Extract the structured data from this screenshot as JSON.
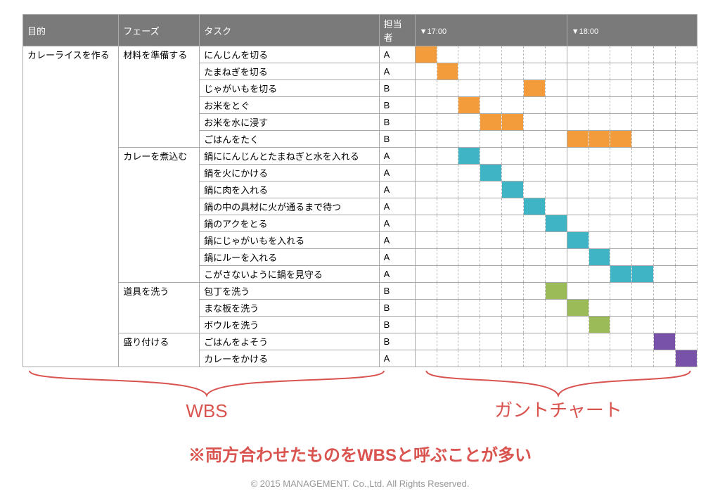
{
  "headers": {
    "purpose": "目的",
    "phase": "フェーズ",
    "task": "タスク",
    "owner": "担当者",
    "time1": "▼17:00",
    "time2": "▼18:00"
  },
  "purpose_label": "カレーライスを作る",
  "phases": [
    {
      "name": "材料を準備する",
      "rows": 6
    },
    {
      "name": "カレーを煮込む",
      "rows": 8
    },
    {
      "name": "道具を洗う",
      "rows": 3
    },
    {
      "name": "盛り付ける",
      "rows": 2
    }
  ],
  "tasks": [
    {
      "task": "にんじんを切る",
      "owner": "A",
      "start": 0,
      "len": 1,
      "color": "orange"
    },
    {
      "task": "たまねぎを切る",
      "owner": "A",
      "start": 1,
      "len": 1,
      "color": "orange"
    },
    {
      "task": "じゃがいもを切る",
      "owner": "B",
      "start": 5,
      "len": 1,
      "color": "orange"
    },
    {
      "task": "お米をとぐ",
      "owner": "B",
      "start": 2,
      "len": 1,
      "color": "orange"
    },
    {
      "task": "お米を水に浸す",
      "owner": "B",
      "start": 3,
      "len": 2,
      "color": "orange"
    },
    {
      "task": "ごはんをたく",
      "owner": "B",
      "start": 7,
      "len": 3,
      "color": "orange"
    },
    {
      "task": "鍋ににんじんとたまねぎと水を入れる",
      "owner": "A",
      "start": 2,
      "len": 1,
      "color": "teal"
    },
    {
      "task": "鍋を火にかける",
      "owner": "A",
      "start": 3,
      "len": 1,
      "color": "teal"
    },
    {
      "task": "鍋に肉を入れる",
      "owner": "A",
      "start": 4,
      "len": 1,
      "color": "teal"
    },
    {
      "task": "鍋の中の具材に火が通るまで待つ",
      "owner": "A",
      "start": 5,
      "len": 1,
      "color": "teal"
    },
    {
      "task": "鍋のアクをとる",
      "owner": "A",
      "start": 6,
      "len": 1,
      "color": "teal"
    },
    {
      "task": "鍋にじゃがいもを入れる",
      "owner": "A",
      "start": 7,
      "len": 1,
      "color": "teal"
    },
    {
      "task": "鍋にルーを入れる",
      "owner": "A",
      "start": 8,
      "len": 1,
      "color": "teal"
    },
    {
      "task": "こがさないように鍋を見守る",
      "owner": "A",
      "start": 9,
      "len": 2,
      "color": "teal"
    },
    {
      "task": "包丁を洗う",
      "owner": "B",
      "start": 6,
      "len": 1,
      "color": "green"
    },
    {
      "task": "まな板を洗う",
      "owner": "B",
      "start": 7,
      "len": 1,
      "color": "green"
    },
    {
      "task": "ボウルを洗う",
      "owner": "B",
      "start": 8,
      "len": 1,
      "color": "green"
    },
    {
      "task": "ごはんをよそう",
      "owner": "B",
      "start": 11,
      "len": 1,
      "color": "purple"
    },
    {
      "task": "カレーをかける",
      "owner": "A",
      "start": 12,
      "len": 1,
      "color": "purple"
    }
  ],
  "labels": {
    "wbs": "WBS",
    "gantt": "ガントチャート",
    "note": "※両方合わせたものをWBSと呼ぶことが多い",
    "copyright": "© 2015 MANAGEMENT. Co.,Ltd. All Rights Reserved."
  },
  "chart_data": {
    "type": "gantt",
    "title": "カレーライスを作る WBS + ガントチャート",
    "time_axis": {
      "start": "17:00",
      "end": "18:00",
      "slots": 13,
      "major_ticks": [
        "17:00",
        "18:00"
      ]
    },
    "color_legend": {
      "orange": "材料を準備する",
      "teal": "カレーを煮込む",
      "green": "道具を洗う",
      "purple": "盛り付ける"
    },
    "series": [
      {
        "task": "にんじんを切る",
        "owner": "A",
        "phase": "材料を準備する",
        "start_slot": 0,
        "duration": 1
      },
      {
        "task": "たまねぎを切る",
        "owner": "A",
        "phase": "材料を準備する",
        "start_slot": 1,
        "duration": 1
      },
      {
        "task": "じゃがいもを切る",
        "owner": "B",
        "phase": "材料を準備する",
        "start_slot": 5,
        "duration": 1
      },
      {
        "task": "お米をとぐ",
        "owner": "B",
        "phase": "材料を準備する",
        "start_slot": 2,
        "duration": 1
      },
      {
        "task": "お米を水に浸す",
        "owner": "B",
        "phase": "材料を準備する",
        "start_slot": 3,
        "duration": 2
      },
      {
        "task": "ごはんをたく",
        "owner": "B",
        "phase": "材料を準備する",
        "start_slot": 7,
        "duration": 3
      },
      {
        "task": "鍋ににんじんとたまねぎと水を入れる",
        "owner": "A",
        "phase": "カレーを煮込む",
        "start_slot": 2,
        "duration": 1
      },
      {
        "task": "鍋を火にかける",
        "owner": "A",
        "phase": "カレーを煮込む",
        "start_slot": 3,
        "duration": 1
      },
      {
        "task": "鍋に肉を入れる",
        "owner": "A",
        "phase": "カレーを煮込む",
        "start_slot": 4,
        "duration": 1
      },
      {
        "task": "鍋の中の具材に火が通るまで待つ",
        "owner": "A",
        "phase": "カレーを煮込む",
        "start_slot": 5,
        "duration": 1
      },
      {
        "task": "鍋のアクをとる",
        "owner": "A",
        "phase": "カレーを煮込む",
        "start_slot": 6,
        "duration": 1
      },
      {
        "task": "鍋にじゃがいもを入れる",
        "owner": "A",
        "phase": "カレーを煮込む",
        "start_slot": 7,
        "duration": 1
      },
      {
        "task": "鍋にルーを入れる",
        "owner": "A",
        "phase": "カレーを煮込む",
        "start_slot": 8,
        "duration": 1
      },
      {
        "task": "こがさないように鍋を見守る",
        "owner": "A",
        "phase": "カレーを煮込む",
        "start_slot": 9,
        "duration": 2
      },
      {
        "task": "包丁を洗う",
        "owner": "B",
        "phase": "道具を洗う",
        "start_slot": 6,
        "duration": 1
      },
      {
        "task": "まな板を洗う",
        "owner": "B",
        "phase": "道具を洗う",
        "start_slot": 7,
        "duration": 1
      },
      {
        "task": "ボウルを洗う",
        "owner": "B",
        "phase": "道具を洗う",
        "start_slot": 8,
        "duration": 1
      },
      {
        "task": "ごはんをよそう",
        "owner": "B",
        "phase": "盛り付ける",
        "start_slot": 11,
        "duration": 1
      },
      {
        "task": "カレーをかける",
        "owner": "A",
        "phase": "盛り付ける",
        "start_slot": 12,
        "duration": 1
      }
    ]
  }
}
